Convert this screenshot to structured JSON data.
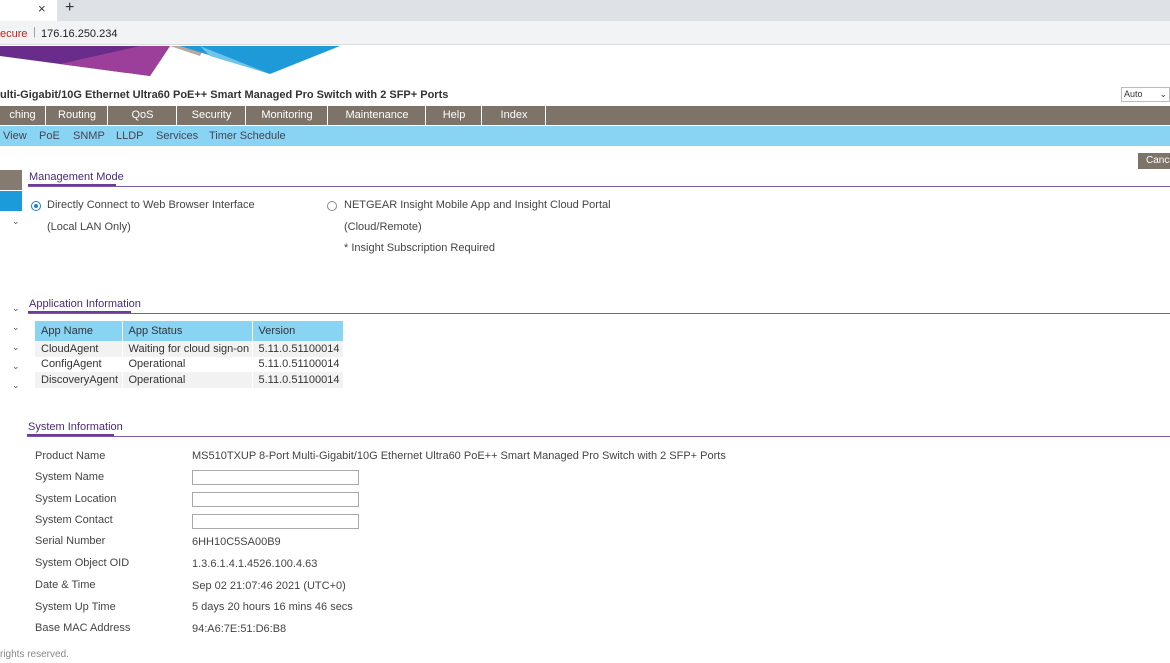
{
  "browser": {
    "tab_close": "×",
    "new_tab": "+",
    "security_label": "ecure",
    "separator": "|",
    "url": "176.16.250.234"
  },
  "header": {
    "title": "ulti-Gigabit/10G Ethernet Ultra60 PoE++ Smart Managed Pro Switch with 2 SFP+ Ports",
    "language": "Auto"
  },
  "main_nav": [
    "ching",
    "Routing",
    "QoS",
    "Security",
    "Monitoring",
    "Maintenance",
    "Help",
    "Index"
  ],
  "sub_nav": [
    "View",
    "PoE",
    "SNMP",
    "LLDP",
    "Services",
    "Timer Schedule"
  ],
  "cancel_label": "Cance",
  "management_mode": {
    "heading": "Management Mode",
    "option1": {
      "label": "Directly Connect to Web Browser Interface",
      "note": "(Local LAN Only)",
      "selected": true
    },
    "option2": {
      "label": "NETGEAR Insight Mobile App and Insight Cloud Portal",
      "note": "(Cloud/Remote)",
      "note2": "* Insight Subscription Required",
      "selected": false
    }
  },
  "application_info": {
    "heading": "Application Information",
    "columns": [
      "App Name",
      "App Status",
      "Version"
    ],
    "rows": [
      [
        "CloudAgent",
        "Waiting for cloud sign-on",
        "5.11.0.51100014"
      ],
      [
        "ConfigAgent",
        "Operational",
        "5.11.0.51100014"
      ],
      [
        "DiscoveryAgent",
        "Operational",
        "5.11.0.51100014"
      ]
    ]
  },
  "system_info": {
    "heading": "System Information",
    "product_name": {
      "label": "Product Name",
      "value": "MS510TXUP 8-Port Multi-Gigabit/10G Ethernet Ultra60 PoE++ Smart Managed Pro Switch with 2 SFP+ Ports"
    },
    "system_name": {
      "label": "System Name",
      "value": ""
    },
    "system_location": {
      "label": "System Location",
      "value": ""
    },
    "system_contact": {
      "label": "System Contact",
      "value": ""
    },
    "serial_number": {
      "label": "Serial Number",
      "value": "6HH10C5SA00B9"
    },
    "object_oid": {
      "label": "System Object OID",
      "value": "1.3.6.1.4.1.4526.100.4.63"
    },
    "date_time": {
      "label": "Date & Time",
      "value": "Sep 02 21:07:46 2021 (UTC+0)"
    },
    "up_time": {
      "label": "System Up Time",
      "value": "5 days 20 hours 16 mins 46 secs"
    },
    "base_mac": {
      "label": "Base MAC Address",
      "value": "94:A6:7E:51:D6:B8"
    }
  },
  "footer": "rights reserved.",
  "colors": {
    "nav_bg": "#7e7368",
    "subnav_bg": "#8ad4f3",
    "section_purple": "#6d3a9c",
    "selected_blue": "#1d9ad9"
  }
}
